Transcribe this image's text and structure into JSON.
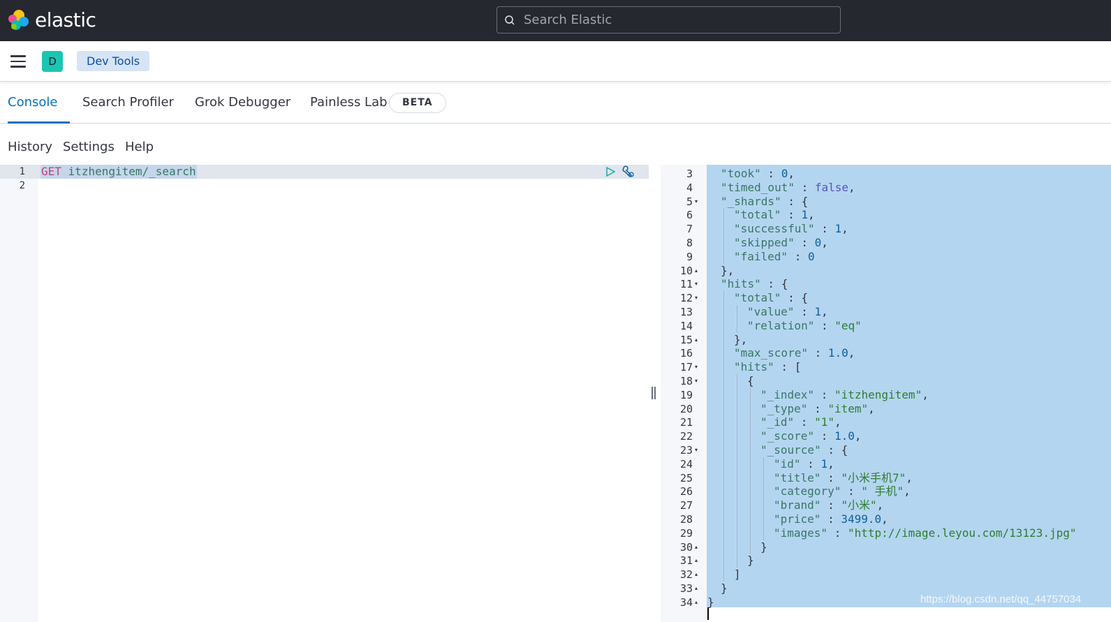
{
  "header": {
    "brand": "elastic",
    "search_placeholder": "Search Elastic"
  },
  "navbar": {
    "avatar_letter": "D",
    "breadcrumb": "Dev Tools"
  },
  "tabs": [
    {
      "label": "Console",
      "active": true
    },
    {
      "label": "Search Profiler",
      "active": false
    },
    {
      "label": "Grok Debugger",
      "active": false
    },
    {
      "label": "Painless Lab",
      "active": false
    }
  ],
  "beta_badge": "BETA",
  "console_menu": [
    "History",
    "Settings",
    "Help"
  ],
  "request": {
    "line_numbers": [
      "1",
      "2"
    ],
    "method": "GET",
    "path": "itzhengitem/_search"
  },
  "response": {
    "lines": [
      {
        "num": "3",
        "fold": "",
        "indent": 1,
        "text": "\"took\" : 0,"
      },
      {
        "num": "4",
        "fold": "",
        "indent": 1,
        "text": "\"timed_out\" : false,"
      },
      {
        "num": "5",
        "fold": "down",
        "indent": 1,
        "text": "\"_shards\" : {"
      },
      {
        "num": "6",
        "fold": "",
        "indent": 2,
        "text": "\"total\" : 1,"
      },
      {
        "num": "7",
        "fold": "",
        "indent": 2,
        "text": "\"successful\" : 1,"
      },
      {
        "num": "8",
        "fold": "",
        "indent": 2,
        "text": "\"skipped\" : 0,"
      },
      {
        "num": "9",
        "fold": "",
        "indent": 2,
        "text": "\"failed\" : 0"
      },
      {
        "num": "10",
        "fold": "up",
        "indent": 1,
        "text": "},"
      },
      {
        "num": "11",
        "fold": "down",
        "indent": 1,
        "text": "\"hits\" : {"
      },
      {
        "num": "12",
        "fold": "down",
        "indent": 2,
        "text": "\"total\" : {"
      },
      {
        "num": "13",
        "fold": "",
        "indent": 3,
        "text": "\"value\" : 1,"
      },
      {
        "num": "14",
        "fold": "",
        "indent": 3,
        "text": "\"relation\" : \"eq\""
      },
      {
        "num": "15",
        "fold": "up",
        "indent": 2,
        "text": "},"
      },
      {
        "num": "16",
        "fold": "",
        "indent": 2,
        "text": "\"max_score\" : 1.0,"
      },
      {
        "num": "17",
        "fold": "down",
        "indent": 2,
        "text": "\"hits\" : ["
      },
      {
        "num": "18",
        "fold": "down",
        "indent": 3,
        "text": "{"
      },
      {
        "num": "19",
        "fold": "",
        "indent": 4,
        "text": "\"_index\" : \"itzhengitem\","
      },
      {
        "num": "20",
        "fold": "",
        "indent": 4,
        "text": "\"_type\" : \"item\","
      },
      {
        "num": "21",
        "fold": "",
        "indent": 4,
        "text": "\"_id\" : \"1\","
      },
      {
        "num": "22",
        "fold": "",
        "indent": 4,
        "text": "\"_score\" : 1.0,"
      },
      {
        "num": "23",
        "fold": "down",
        "indent": 4,
        "text": "\"_source\" : {"
      },
      {
        "num": "24",
        "fold": "",
        "indent": 5,
        "text": "\"id\" : 1,"
      },
      {
        "num": "25",
        "fold": "",
        "indent": 5,
        "text": "\"title\" : \"小米手机7\","
      },
      {
        "num": "26",
        "fold": "",
        "indent": 5,
        "text": "\"category\" : \" 手机\","
      },
      {
        "num": "27",
        "fold": "",
        "indent": 5,
        "text": "\"brand\" : \"小米\","
      },
      {
        "num": "28",
        "fold": "",
        "indent": 5,
        "text": "\"price\" : 3499.0,"
      },
      {
        "num": "29",
        "fold": "",
        "indent": 5,
        "text": "\"images\" : \"http://image.leyou.com/13123.jpg\""
      },
      {
        "num": "30",
        "fold": "up",
        "indent": 4,
        "text": "}"
      },
      {
        "num": "31",
        "fold": "up",
        "indent": 3,
        "text": "}"
      },
      {
        "num": "32",
        "fold": "up",
        "indent": 2,
        "text": "]"
      },
      {
        "num": "33",
        "fold": "up",
        "indent": 1,
        "text": "}"
      },
      {
        "num": "34",
        "fold": "up",
        "indent": 0,
        "text": "}"
      }
    ]
  },
  "watermark": "https://blog.csdn.net/qq_44757034",
  "colors": {
    "header_bg": "#25282f",
    "accent": "#0071c2",
    "selection": "#b4d5f0",
    "method": "#c4407c",
    "path": "#387765"
  }
}
